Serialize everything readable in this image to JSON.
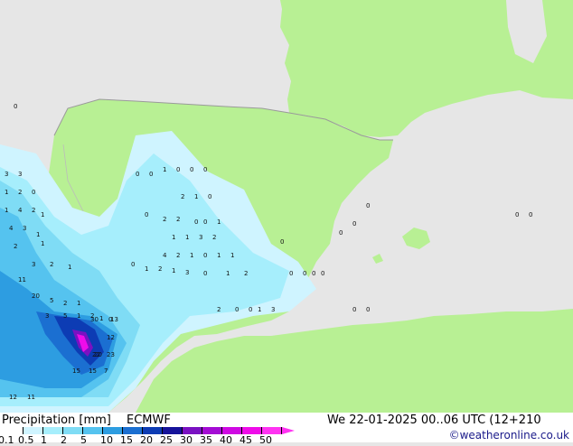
{
  "footer": {
    "title": "Precipitation [mm]",
    "model": "ECMWF",
    "valid_time": "We 22-01-2025 00..06 UTC (12+210",
    "credit": "©weatheronline.co.uk"
  },
  "legend": {
    "ticks": [
      "0.1",
      "0.5",
      "1",
      "2",
      "5",
      "10",
      "15",
      "20",
      "25",
      "30",
      "35",
      "40",
      "45",
      "50"
    ],
    "colors": [
      "#ffffff",
      "#cff4ff",
      "#a6eefc",
      "#7fdcf5",
      "#55c3ef",
      "#2d9de1",
      "#1b6fd1",
      "#0d3cb4",
      "#16139a",
      "#7a11c2",
      "#a40cd4",
      "#cf09e3",
      "#ef0ce9",
      "#ff33f2"
    ]
  },
  "map": {
    "sea_color": "#e6e6e6",
    "land_color": "#b8f094",
    "coast_color": "#9a9a9a",
    "rain_colors": [
      "#cff4ff",
      "#a6eefc",
      "#7fdcf5",
      "#55c3ef",
      "#2d9de1",
      "#1b6fd1",
      "#0d3cb4",
      "#7a11c2",
      "#ef0ce9"
    ],
    "labels": [
      {
        "t": "0",
        "c": "r"
      },
      {
        "t": "3",
        "c": "r"
      },
      {
        "t": "3",
        "c": "r"
      },
      {
        "t": "1",
        "c": "r"
      },
      {
        "t": "2",
        "c": "r"
      },
      {
        "t": "0",
        "c": "r"
      },
      {
        "t": "1",
        "c": "r"
      },
      {
        "t": "4",
        "c": "r"
      },
      {
        "t": "2",
        "c": "r"
      },
      {
        "t": "1",
        "c": "r"
      },
      {
        "t": "4",
        "c": "r"
      },
      {
        "t": "3",
        "c": "r"
      },
      {
        "t": "1",
        "c": "r"
      },
      {
        "t": "1",
        "c": "r"
      },
      {
        "t": "2",
        "c": "r"
      },
      {
        "t": "3",
        "c": "r"
      },
      {
        "t": "2",
        "c": "r"
      },
      {
        "t": "1",
        "c": "r"
      },
      {
        "t": "11",
        "c": "r"
      },
      {
        "t": "20",
        "c": "r"
      },
      {
        "t": "5",
        "c": "r"
      },
      {
        "t": "2",
        "c": "r"
      },
      {
        "t": "1",
        "c": "r"
      },
      {
        "t": "3",
        "c": "r"
      },
      {
        "t": "5",
        "c": "r"
      },
      {
        "t": "1",
        "c": "r"
      },
      {
        "t": "2",
        "c": "r"
      },
      {
        "t": "1",
        "c": "r"
      },
      {
        "t": "0",
        "c": "r"
      },
      {
        "t": "13",
        "c": "r"
      },
      {
        "t": "30",
        "c": "r"
      },
      {
        "t": "12",
        "c": "r"
      },
      {
        "t": "23",
        "c": "r"
      },
      {
        "t": "20",
        "c": "r"
      },
      {
        "t": "15",
        "c": "r"
      },
      {
        "t": "22",
        "c": "r"
      },
      {
        "t": "15",
        "c": "r"
      },
      {
        "t": "7",
        "c": "r"
      },
      {
        "t": "12",
        "c": "r"
      },
      {
        "t": "11",
        "c": "r"
      },
      {
        "t": "0",
        "c": "r"
      },
      {
        "t": "1",
        "c": "r"
      },
      {
        "t": "2",
        "c": "r"
      },
      {
        "t": "1",
        "c": "r"
      },
      {
        "t": "3",
        "c": "r"
      },
      {
        "t": "0",
        "c": "r"
      },
      {
        "t": "1",
        "c": "r"
      },
      {
        "t": "2",
        "c": "r"
      },
      {
        "t": "2",
        "c": "r"
      },
      {
        "t": "0",
        "c": "r"
      },
      {
        "t": "0",
        "c": "r"
      },
      {
        "t": "1",
        "c": "r"
      },
      {
        "t": "3",
        "c": "r"
      },
      {
        "t": "2",
        "c": "r"
      },
      {
        "t": "1",
        "c": "r"
      },
      {
        "t": "0",
        "c": "r"
      },
      {
        "t": "0",
        "c": "r"
      },
      {
        "t": "2",
        "c": "r"
      },
      {
        "t": "2",
        "c": "r"
      },
      {
        "t": "0",
        "c": "r"
      },
      {
        "t": "0",
        "c": "r"
      },
      {
        "t": "1",
        "c": "r"
      },
      {
        "t": "1",
        "c": "r"
      },
      {
        "t": "1",
        "c": "r"
      },
      {
        "t": "3",
        "c": "r"
      },
      {
        "t": "2",
        "c": "r"
      },
      {
        "t": "4",
        "c": "r"
      },
      {
        "t": "2",
        "c": "r"
      },
      {
        "t": "1",
        "c": "r"
      },
      {
        "t": "0",
        "c": "r"
      },
      {
        "t": "1",
        "c": "r"
      },
      {
        "t": "1",
        "c": "r"
      },
      {
        "t": "0",
        "c": "r"
      },
      {
        "t": "0",
        "c": "r"
      },
      {
        "t": "1",
        "c": "r"
      },
      {
        "t": "0",
        "c": "r"
      },
      {
        "t": "0",
        "c": "r"
      },
      {
        "t": "0",
        "c": "r"
      },
      {
        "t": "0",
        "c": "r"
      },
      {
        "t": "0",
        "c": "r"
      },
      {
        "t": "0",
        "c": "r"
      },
      {
        "t": "0",
        "c": "r"
      },
      {
        "t": "0",
        "c": "r"
      },
      {
        "t": "0",
        "c": "r"
      },
      {
        "t": "0",
        "c": "r"
      },
      {
        "t": "0",
        "c": "r"
      },
      {
        "t": "0",
        "c": "r"
      },
      {
        "t": "0",
        "c": "r"
      },
      {
        "t": "0",
        "c": "r"
      },
      {
        "t": "0",
        "c": "r"
      }
    ]
  }
}
